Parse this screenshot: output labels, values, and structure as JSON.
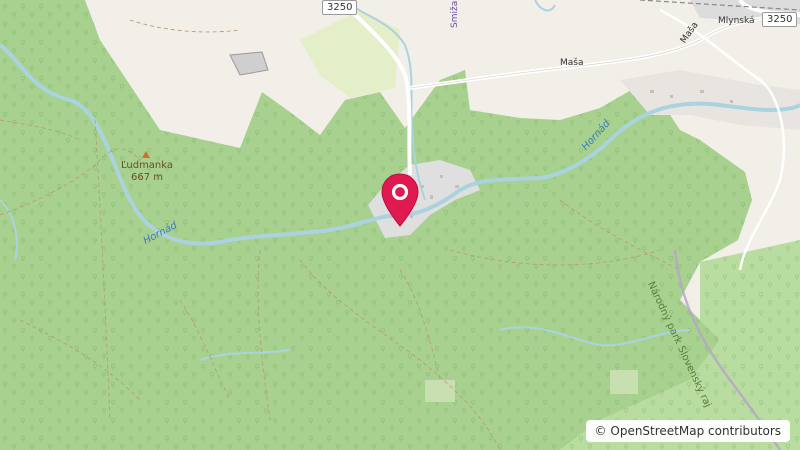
{
  "map": {
    "labels": {
      "road_3250_north": "3250",
      "road_3250_east": "3250",
      "masa_west": "Maša",
      "masa_east": "Maša",
      "mlynska": "Mlynská",
      "smizany": "Smižany",
      "ludmanka_name": "Ľudmanka",
      "ludmanka_elevation": "667 m",
      "hornad_west": "Hornád",
      "hornad_east": "Hornád",
      "national_park": "Národný park Slovenský raj"
    },
    "marker_icon": "map-pin-icon",
    "marker_color": "#e01950",
    "peak_icon": "peak-triangle-icon",
    "colors": {
      "forest": "#a8d18f",
      "open_land": "#f2efe9",
      "water": "#aad3df",
      "residential": "#e0dfdf"
    }
  },
  "attribution": {
    "copyright_symbol": "©",
    "text": "OpenStreetMap contributors"
  }
}
